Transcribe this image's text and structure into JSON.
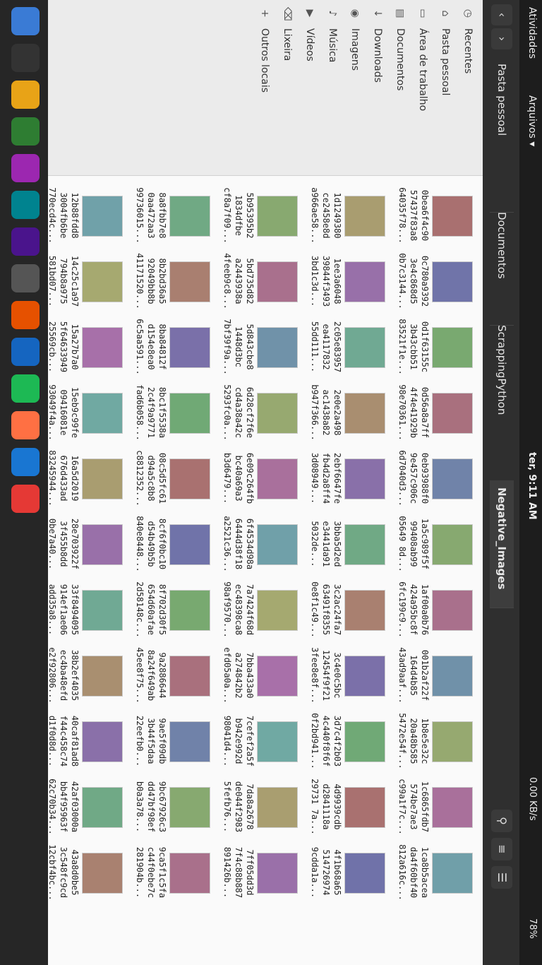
{
  "topbar": {
    "activities": "Atividades",
    "app_name": "Arquivos ▾",
    "clock": "ter, 9:11 AM",
    "net_speed": "0.00 KB/s",
    "battery": "78%"
  },
  "header": {
    "crumbs": [
      {
        "label": "Pasta pessoal"
      },
      {
        "label": "Documentos"
      },
      {
        "label": "ScrappingPython"
      },
      {
        "label": "Negative_Images"
      }
    ]
  },
  "sidebar": {
    "items": [
      {
        "label": "Recentes",
        "icon": "clock-icon"
      },
      {
        "label": "Pasta pessoal",
        "icon": "home-icon"
      },
      {
        "label": "Área de trabalho",
        "icon": "desktop-icon"
      },
      {
        "label": "Documentos",
        "icon": "document-icon"
      },
      {
        "label": "Downloads",
        "icon": "download-icon"
      },
      {
        "label": "Imagens",
        "icon": "camera-icon"
      },
      {
        "label": "Música",
        "icon": "music-icon"
      },
      {
        "label": "Vídeos",
        "icon": "video-icon"
      },
      {
        "label": "Lixeira",
        "icon": "trash-icon"
      },
      {
        "label": "Outros locais",
        "icon": "plus-icon"
      }
    ]
  },
  "files": [
    {
      "name": "0bea6f4c90 57437f83a8 64035f78..."
    },
    {
      "name": "1d1249380 ce2458e8d a966ae58..."
    },
    {
      "name": "5b95395b2 1834dfbe cf8a7f09..."
    },
    {
      "name": "8a8fbb7e8 0aa472aa3 99736015..."
    },
    {
      "name": "12b88fdd8 3004fb6be 770ecd4c..."
    },
    {
      "name": "0c780a9392 3e4c868d5 0b7c3144..."
    },
    {
      "name": "1ee3a6048 39844f3493 3bd1c3d..."
    },
    {
      "name": "5bd735d82 a2443938a 4feeb9c8..."
    },
    {
      "name": "8b2bd36a5 92049bb8b 41171520..."
    },
    {
      "name": "14c25c1a97 794b8a975 581bd07..."
    },
    {
      "name": "0d1f63155c 3b43cbb51 83521f1e..."
    },
    {
      "name": "2c05e83957 ea4117832 55dd111..."
    },
    {
      "name": "5d843cbe8 1448d3bc 7bf39f9a..."
    },
    {
      "name": "8ba84812f d154e8ea0 6c5aa591..."
    },
    {
      "name": "15a27b7a0 5f64633949 25569cb..."
    },
    {
      "name": "0d56a8a7ff 4f4e41929b 98e70361..."
    },
    {
      "name": "2e0e2a498 ac1438a82 b947f366..."
    },
    {
      "name": "6d28cf2f6e cd4a38a42c 5293fc0a..."
    },
    {
      "name": "8bc1f5538a 2c4f9a9771 fad6b058..."
    },
    {
      "name": "15eb9c99fe 09416081e 93049f4a..."
    },
    {
      "name": "0eb93988f0 9e457c906c 6d7040d3..."
    },
    {
      "name": "2ebf6647fe fb4d2a8ff4 3d08949..."
    },
    {
      "name": "6e09c264fb bc40a69a3 b3d6479..."
    },
    {
      "name": "08c5d5fc61 d94a5c8b8 c8812352..."
    },
    {
      "name": "16a5d2019 676d433ad 83245944..."
    },
    {
      "name": "1a5c989f5f 99408ab99 05649 8d..."
    },
    {
      "name": "3bba5d2ed e3441da91 5032de..."
    },
    {
      "name": "6f4534d98a 6444d38f18 a2521c36..."
    },
    {
      "name": "8cf6f0bc10 d54b49b5b 840e8448..."
    },
    {
      "name": "28e703922f 3f455b8dd 0be7a40..."
    },
    {
      "name": "1af00a0b76 424a95bc8f 6fc199c9..."
    },
    {
      "name": "3c2ac24fa7 63491f8355 0e8f1c49..."
    },
    {
      "name": "7a7424f68d ec48398ca8 98af9570..."
    },
    {
      "name": "8f702d30f5 654d60afae 2d58148c..."
    },
    {
      "name": "33f8494095 914ef1ae06 add35a8..."
    },
    {
      "name": "001b2af22f 164d4b85 43ad9aaf..."
    },
    {
      "name": "3c4e0c5bc 12454f9f21 3fee8e8f..."
    },
    {
      "name": "7bba433a0 a274842b2 efd05a0a..."
    },
    {
      "name": "9a2886644 8a24f649ab 45ee8f75..."
    },
    {
      "name": "38b2ef4035 ec4ba48efd e2f92806..."
    },
    {
      "name": "1b8e5e32c 20a48b585 5472e54f..."
    },
    {
      "name": "3d7c4f2b03 4c440f8f6f 0f2bd941..."
    },
    {
      "name": "7cefef2a5f b942e992d 98041d4..."
    },
    {
      "name": "9ae5f09db 3b44f5daa 22eefb0..."
    },
    {
      "name": "40caf81ad8 f44c458c74 d1f0d8d..."
    },
    {
      "name": "1c6865fdb7 574be7ae3 c99a1f7c..."
    },
    {
      "name": "4d9939cdb d2841118a 29731 7a..."
    },
    {
      "name": "7da8a2678 de044f2983 5fefb76..."
    },
    {
      "name": "9bc67926c3 dd47bf98ef b0a3a78..."
    },
    {
      "name": "42af03000a bb4f95963f 62c70b34..."
    },
    {
      "name": "1ca8b5acea da4f60bf40 812a616c..."
    },
    {
      "name": "4f1b68a65 514726974 9cdda1a..."
    },
    {
      "name": "7ff05dd3d 7f4c88b887 891426b..."
    },
    {
      "name": "9ca5f1c5fa c44f0ebe7c 281904b..."
    },
    {
      "name": "43a8d0be5 3c548fc9cd 12cbf4bc..."
    }
  ],
  "colors": {
    "topbar": "#1d1d1d",
    "header": "#2f2f2f",
    "sidebar": "#ebebeb",
    "grid": "#fafafa"
  }
}
